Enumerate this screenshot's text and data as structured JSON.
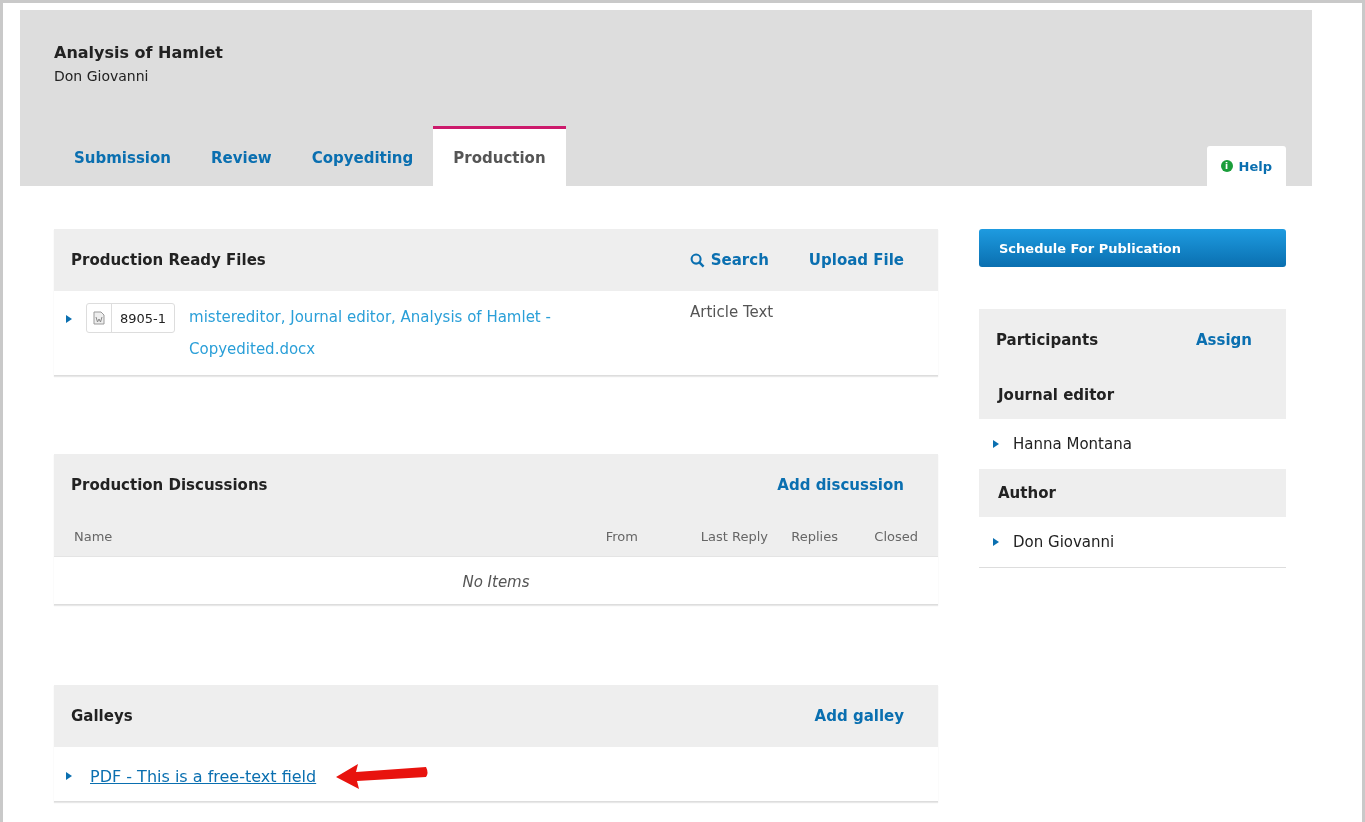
{
  "header": {
    "title": "Analysis of Hamlet",
    "author": "Don Giovanni"
  },
  "tabs": [
    {
      "label": "Submission",
      "selected": false
    },
    {
      "label": "Review",
      "selected": false
    },
    {
      "label": "Copyediting",
      "selected": false
    },
    {
      "label": "Production",
      "selected": true
    }
  ],
  "help": {
    "icon": "i",
    "label": "Help"
  },
  "ready_files": {
    "title": "Production Ready Files",
    "actions": [
      {
        "kind": "search",
        "label": "Search"
      },
      {
        "kind": "plain",
        "label": "Upload File"
      }
    ],
    "rows": [
      {
        "id": "8905-1",
        "name": "mistereditor, Journal editor, Analysis of Hamlet - Copyedited.docx",
        "type": "Article Text"
      }
    ]
  },
  "discussions": {
    "title": "Production Discussions",
    "action": "Add discussion",
    "columns": [
      "Name",
      "From",
      "Last Reply",
      "Replies",
      "Closed"
    ],
    "empty": "No Items"
  },
  "galleys": {
    "title": "Galleys",
    "action": "Add galley",
    "rows": [
      {
        "label": "PDF - This is a free-text field",
        "annotated": true
      }
    ]
  },
  "schedule_button": "Schedule For Publication",
  "participants": {
    "title": "Participants",
    "action": "Assign",
    "groups": [
      {
        "role": "Journal editor",
        "people": [
          "Hanna Montana"
        ]
      },
      {
        "role": "Author",
        "people": [
          "Don Giovanni"
        ]
      }
    ]
  }
}
